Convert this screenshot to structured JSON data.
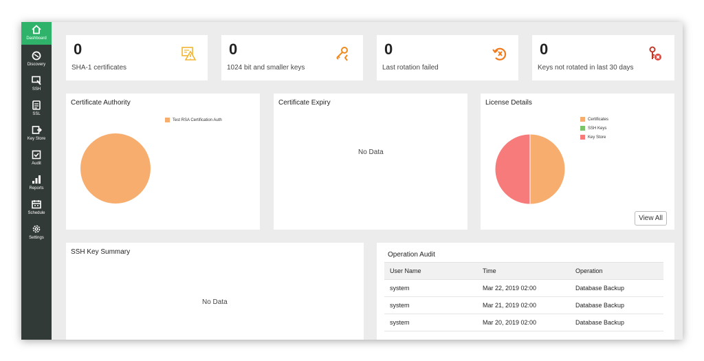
{
  "sidebar": {
    "items": [
      {
        "label": "Dashboard",
        "icon": "home-icon",
        "active": true
      },
      {
        "label": "Discovery",
        "icon": "discovery-icon"
      },
      {
        "label": "SSH",
        "icon": "ssh-icon"
      },
      {
        "label": "SSL",
        "icon": "ssl-icon"
      },
      {
        "label": "Key Store",
        "icon": "key-store-icon"
      },
      {
        "label": "Audit",
        "icon": "audit-icon"
      },
      {
        "label": "Reports",
        "icon": "reports-icon"
      },
      {
        "label": "Schedule",
        "icon": "schedule-icon"
      },
      {
        "label": "Settings",
        "icon": "settings-icon"
      }
    ]
  },
  "stats": [
    {
      "value": "0",
      "label": "SHA-1 certificates",
      "icon": "certificate-warning-icon",
      "color": "#f2b632"
    },
    {
      "value": "0",
      "label": "1024 bit and smaller keys",
      "icon": "key-warning-icon",
      "color": "#f08a1c"
    },
    {
      "value": "0",
      "label": "Last rotation failed",
      "icon": "rotation-failed-icon",
      "color": "#f07a1c"
    },
    {
      "value": "0",
      "label": "Keys not rotated in last 30 days",
      "icon": "key-error-icon",
      "color": "#e0463c"
    }
  ],
  "certificate_authority": {
    "title": "Certificate Authority",
    "legend": [
      "Test RSA Certification Auth"
    ],
    "colors": [
      "#f7ad6e"
    ]
  },
  "certificate_expiry": {
    "title": "Certificate Expiry",
    "no_data": "No Data"
  },
  "license": {
    "title": "License Details",
    "legend": [
      "Certificates",
      "SSH Keys",
      "Key Store"
    ],
    "colors": [
      "#f7ad6e",
      "#7cc46a",
      "#f77b7b"
    ],
    "view_all": "View All"
  },
  "ssh_summary": {
    "title": "SSH Key Summary",
    "no_data": "No Data"
  },
  "audit": {
    "title": "Operation Audit",
    "columns": [
      "User Name",
      "Time",
      "Operation"
    ],
    "rows": [
      [
        "system",
        "Mar 22, 2019 02:00",
        "Database Backup"
      ],
      [
        "system",
        "Mar 21, 2019 02:00",
        "Database Backup"
      ],
      [
        "system",
        "Mar 20, 2019 02:00",
        "Database Backup"
      ]
    ]
  },
  "chart_data": [
    {
      "type": "pie",
      "title": "Certificate Authority",
      "categories": [
        "Test RSA Certification Auth"
      ],
      "values": [
        100
      ]
    },
    {
      "type": "pie",
      "title": "License Details",
      "categories": [
        "Certificates",
        "SSH Keys",
        "Key Store"
      ],
      "values": [
        50,
        0,
        50
      ]
    }
  ]
}
